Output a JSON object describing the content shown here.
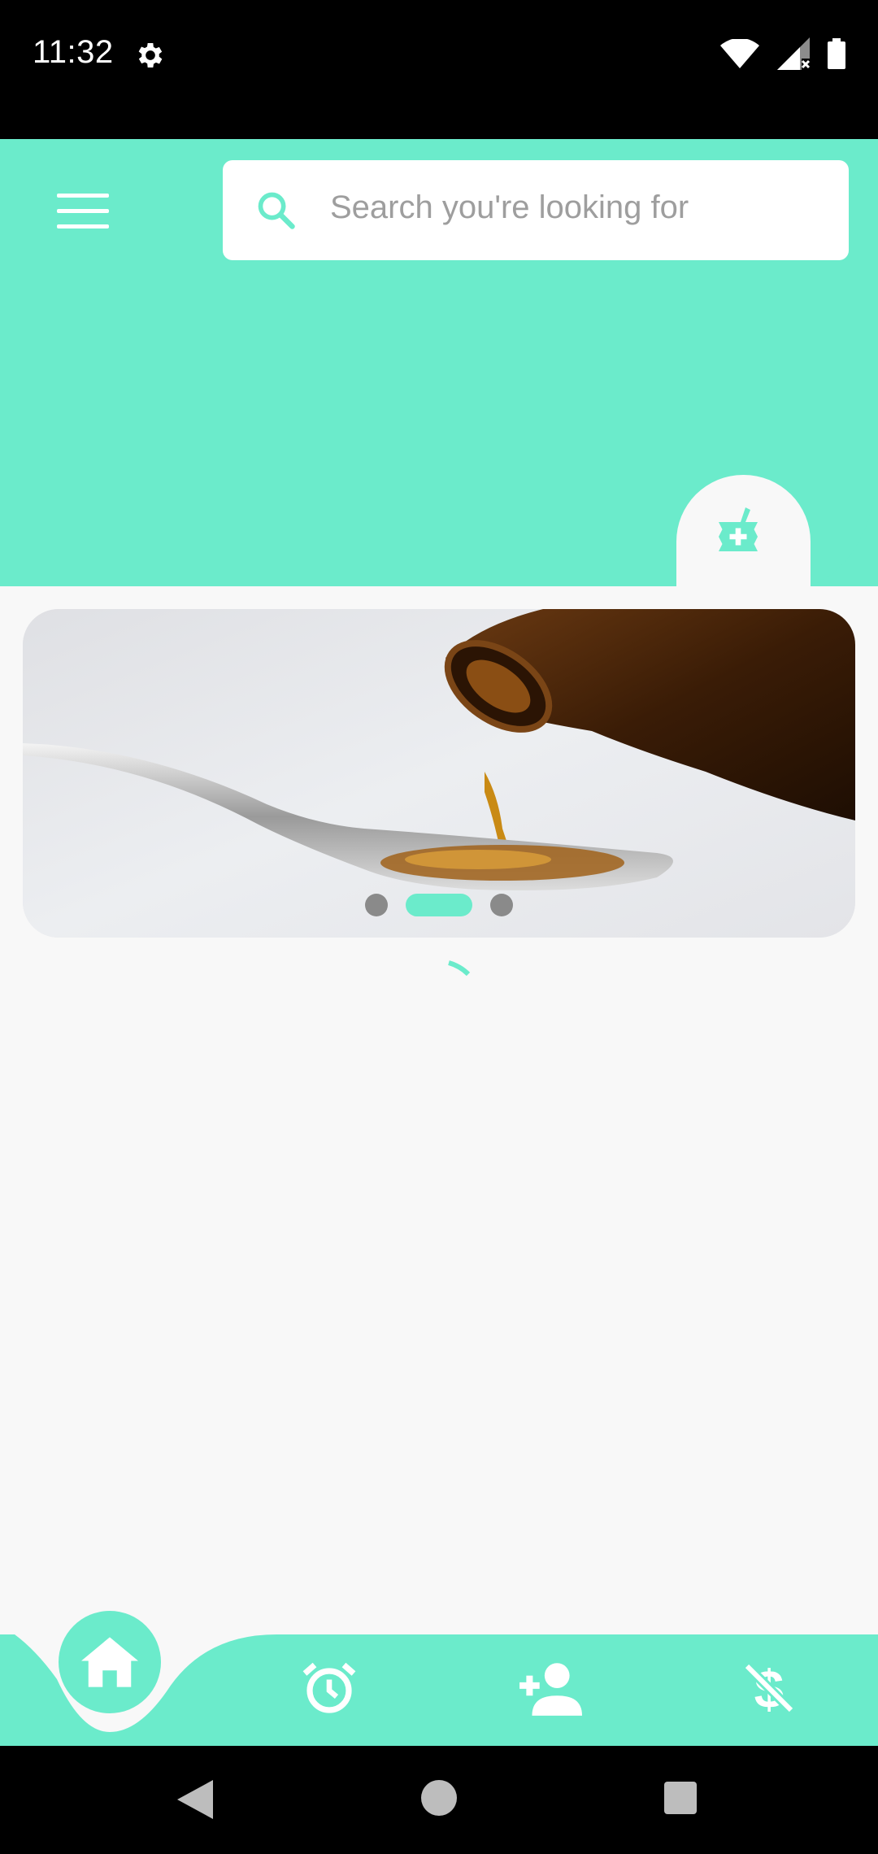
{
  "status_bar": {
    "time": "11:32",
    "icons": [
      "gear-icon",
      "wifi-icon",
      "signal-icon",
      "battery-icon"
    ]
  },
  "header": {
    "menu_icon": "hamburger-menu-icon",
    "search": {
      "placeholder": "Search you're looking for",
      "icon": "search-icon"
    },
    "pharmacy_icon": "mortar-pestle-icon"
  },
  "carousel": {
    "image": "syrup-bottle-spoon-image",
    "dots_count": 3,
    "active_index": 1
  },
  "loading": true,
  "bottom_nav": {
    "items": [
      {
        "icon": "home-icon",
        "active": true
      },
      {
        "icon": "alarm-clock-icon",
        "active": false
      },
      {
        "icon": "add-person-icon",
        "active": false
      },
      {
        "icon": "money-off-icon",
        "active": false
      }
    ]
  },
  "system_nav": [
    "back-icon",
    "home-circle-icon",
    "recents-icon"
  ],
  "colors": {
    "accent": "#6bebcb",
    "background": "#f8f8f8",
    "placeholder": "#9e9e9e"
  }
}
